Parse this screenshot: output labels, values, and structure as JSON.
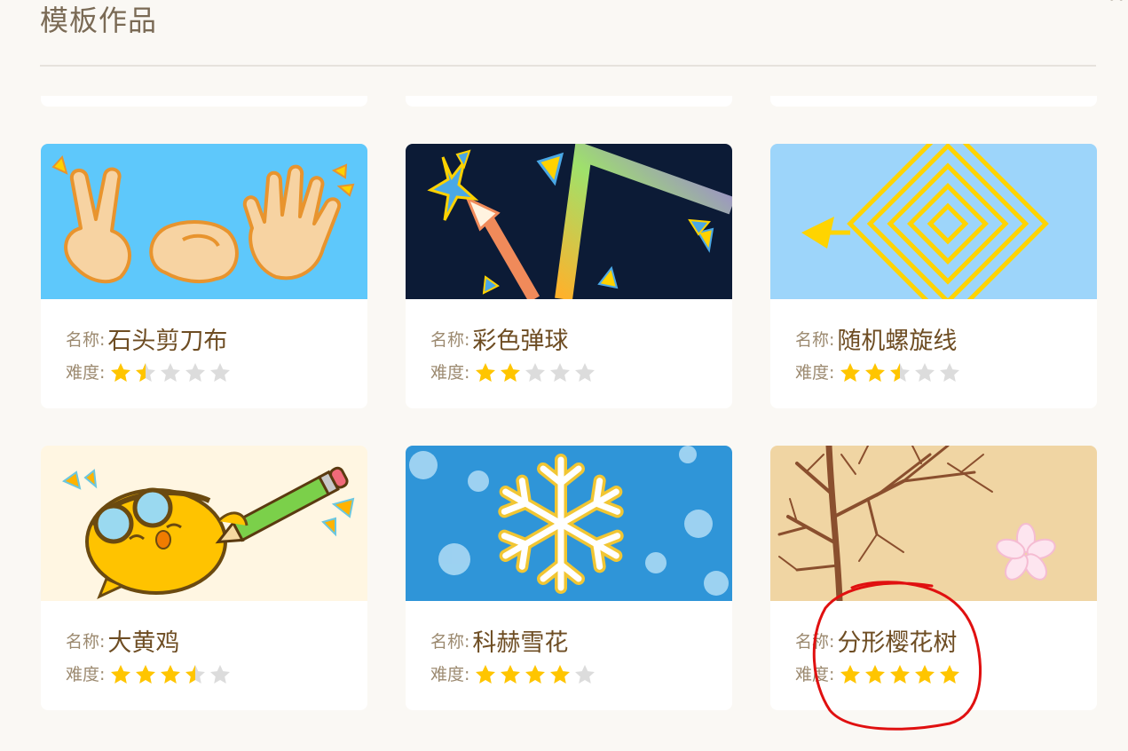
{
  "page": {
    "title": "模板作品"
  },
  "colors": {
    "star_on": "#ffc500",
    "star_off": "#dcdcdc",
    "annotation": "#e01010"
  },
  "cards": [
    {
      "name_label": "名称:",
      "name": "石头剪刀布",
      "difficulty_label": "难度:",
      "rating": 1.5,
      "thumb_icon": "rock-paper-scissors-hands"
    },
    {
      "name_label": "名称:",
      "name": "彩色弹球",
      "difficulty_label": "难度:",
      "rating": 2,
      "thumb_icon": "bouncing-ball-arrow"
    },
    {
      "name_label": "名称:",
      "name": "随机螺旋线",
      "difficulty_label": "难度:",
      "rating": 2.5,
      "thumb_icon": "square-spiral"
    },
    {
      "name_label": "名称:",
      "name": "大黄鸡",
      "difficulty_label": "难度:",
      "rating": 3.5,
      "thumb_icon": "yellow-chick-with-pencil"
    },
    {
      "name_label": "名称:",
      "name": "科赫雪花",
      "difficulty_label": "难度:",
      "rating": 4,
      "thumb_icon": "koch-snowflake"
    },
    {
      "name_label": "名称:",
      "name": "分形樱花树",
      "difficulty_label": "难度:",
      "rating": 5,
      "thumb_icon": "fractal-cherry-tree"
    }
  ]
}
